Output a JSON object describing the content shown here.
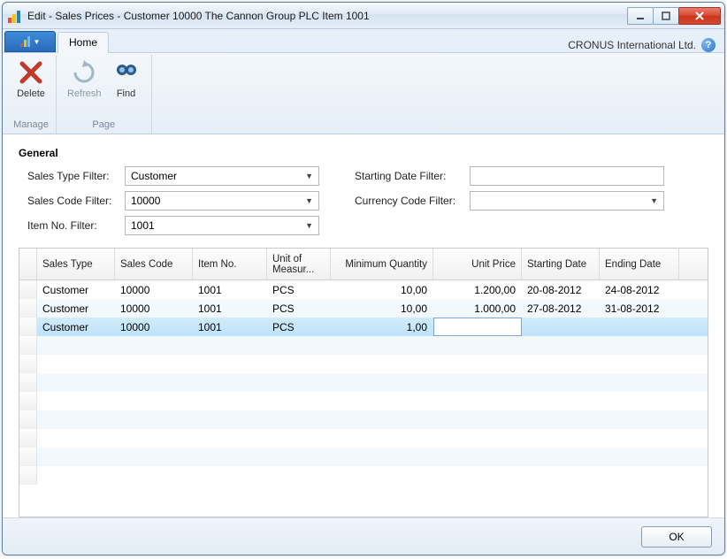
{
  "window": {
    "title": "Edit - Sales Prices - Customer 10000 The Cannon Group PLC Item 1001"
  },
  "ribbon": {
    "company": "CRONUS International Ltd.",
    "tabs": {
      "home": "Home"
    },
    "groups": {
      "manage": {
        "label": "Manage",
        "delete": "Delete"
      },
      "page": {
        "label": "Page",
        "refresh": "Refresh",
        "find": "Find"
      }
    }
  },
  "filters": {
    "section": "General",
    "sales_type": {
      "label": "Sales Type Filter:",
      "value": "Customer"
    },
    "sales_code": {
      "label": "Sales Code Filter:",
      "value": "10000"
    },
    "item_no": {
      "label": "Item No. Filter:",
      "value": "1001"
    },
    "starting_date": {
      "label": "Starting Date Filter:",
      "value": ""
    },
    "currency_code": {
      "label": "Currency Code Filter:",
      "value": ""
    }
  },
  "grid": {
    "columns": {
      "sales_type": "Sales Type",
      "sales_code": "Sales Code",
      "item_no": "Item No.",
      "uom": "Unit of Measur...",
      "min_qty": "Minimum Quantity",
      "unit_price": "Unit Price",
      "start_date": "Starting Date",
      "end_date": "Ending Date"
    },
    "rows": [
      {
        "sales_type": "Customer",
        "sales_code": "10000",
        "item_no": "1001",
        "uom": "PCS",
        "min_qty": "10,00",
        "unit_price": "1.200,00",
        "start_date": "20-08-2012",
        "end_date": "24-08-2012"
      },
      {
        "sales_type": "Customer",
        "sales_code": "10000",
        "item_no": "1001",
        "uom": "PCS",
        "min_qty": "10,00",
        "unit_price": "1.000,00",
        "start_date": "27-08-2012",
        "end_date": "31-08-2012"
      },
      {
        "sales_type": "Customer",
        "sales_code": "10000",
        "item_no": "1001",
        "uom": "PCS",
        "min_qty": "1,00",
        "unit_price": "",
        "start_date": "",
        "end_date": ""
      }
    ]
  },
  "footer": {
    "ok": "OK"
  }
}
